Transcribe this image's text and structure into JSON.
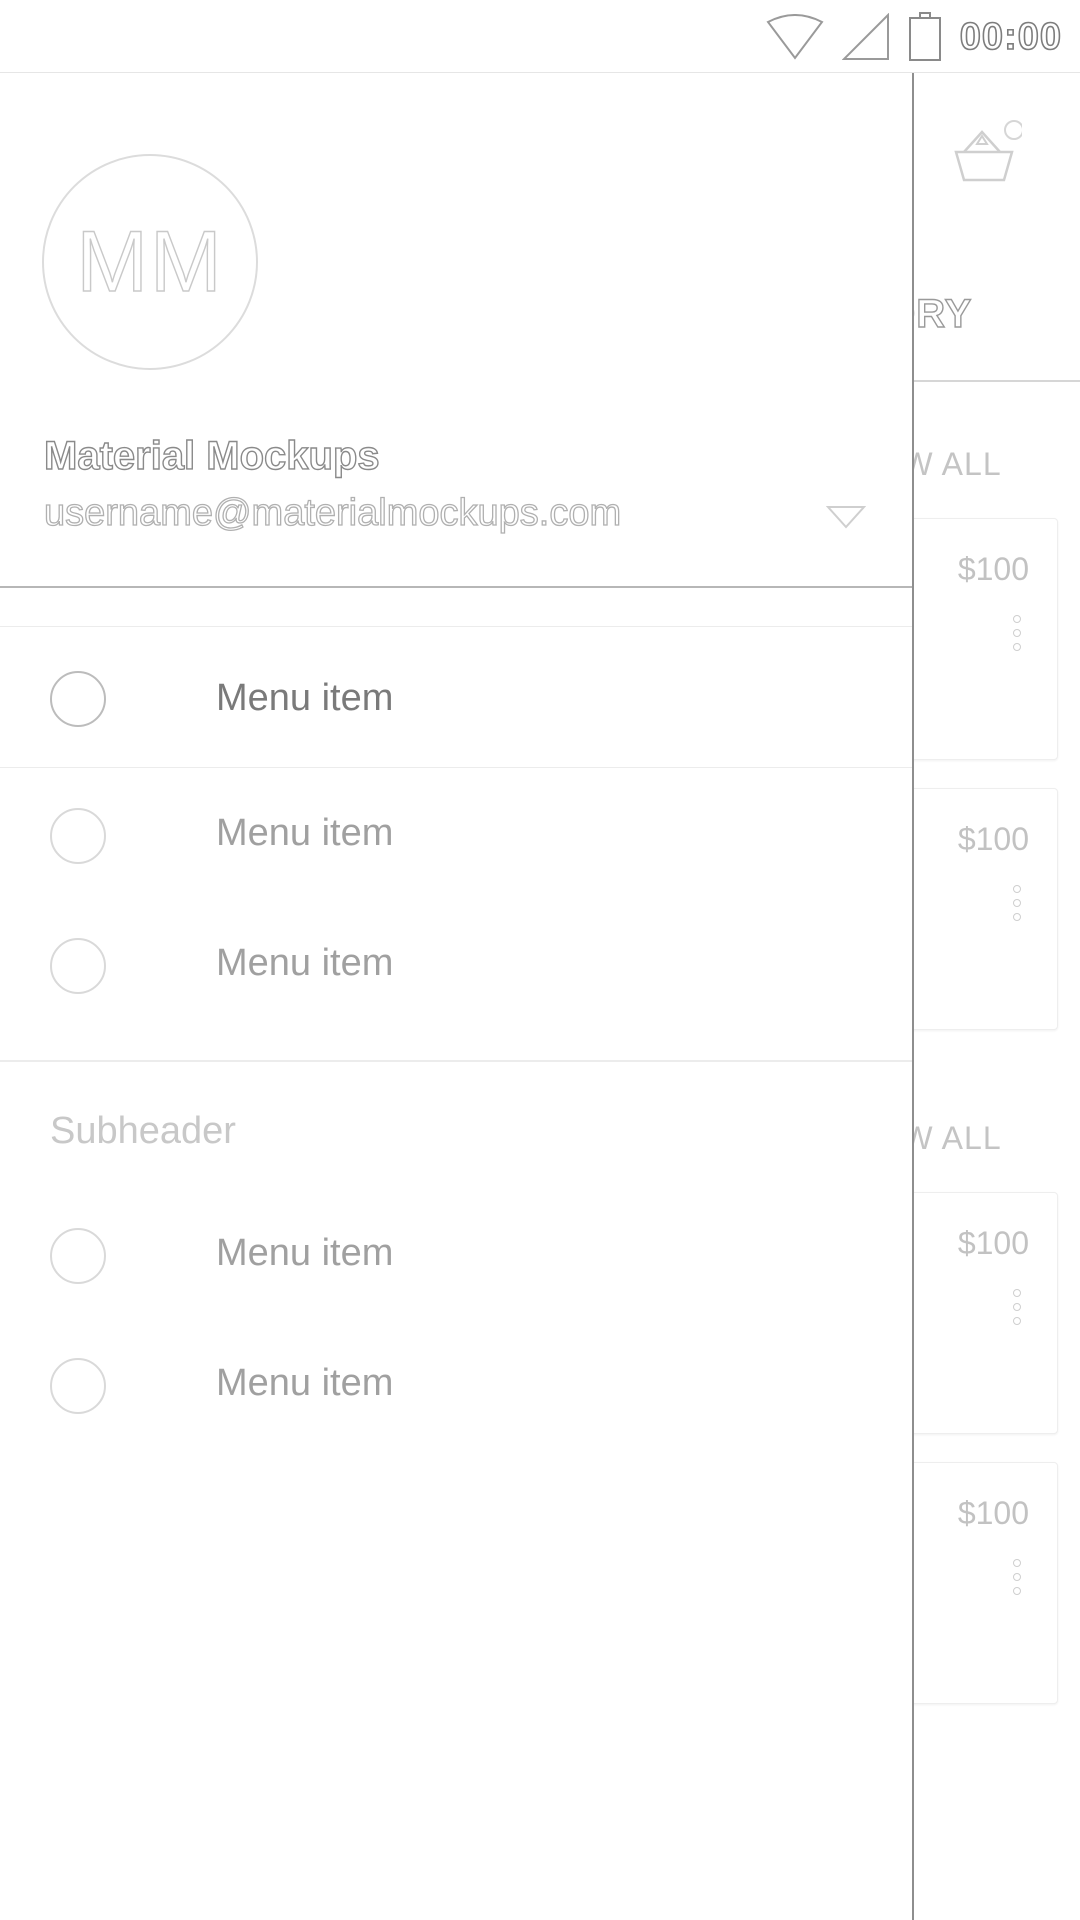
{
  "status_bar": {
    "time": "00:00",
    "icons": [
      "wifi-icon",
      "cell-signal-icon",
      "battery-icon"
    ]
  },
  "background_app": {
    "tab_label": "GORY",
    "section_links": [
      "EW ALL",
      "EW ALL"
    ],
    "cards": [
      {
        "price": "$100"
      },
      {
        "price": "$100"
      },
      {
        "price": "$100"
      },
      {
        "price": "$100"
      }
    ],
    "cart_icon": "shopping-basket-icon"
  },
  "drawer": {
    "avatar_initials": "MM",
    "user_name": "Material Mockups",
    "user_email": "username@materialmockups.com",
    "primary_items": [
      {
        "label": "Menu item",
        "selected": true
      },
      {
        "label": "Menu item",
        "selected": false
      },
      {
        "label": "Menu item",
        "selected": false
      }
    ],
    "subheader": "Subheader",
    "secondary_items": [
      {
        "label": "Menu item"
      },
      {
        "label": "Menu item"
      }
    ]
  },
  "colors": {
    "divider": "#ececec",
    "drawer_edge": "#8e8e8e",
    "muted_text": "#a0a0a0"
  }
}
